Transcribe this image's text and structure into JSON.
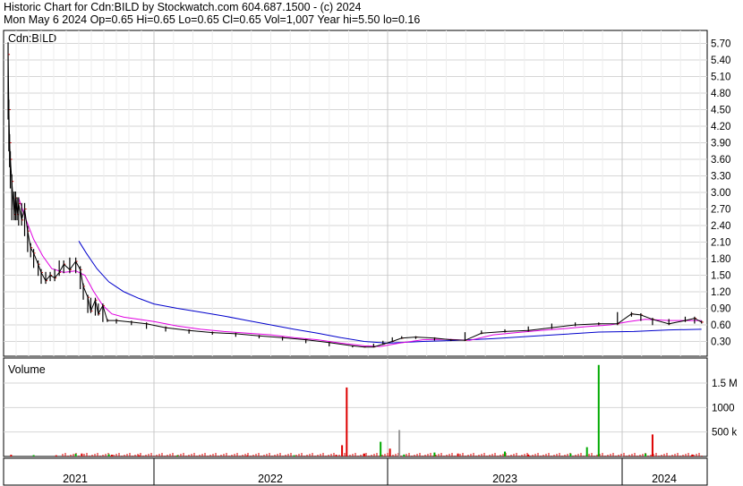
{
  "header": {
    "line1": "Historic Chart for Cdn:BILD by Stockwatch.com 604.687.1500 - (c) 2024",
    "line2": "Mon May  6 2024  Op=0.65  Hi=0.65  Lo=0.65  Cl=0.65  Vol=1,007  Year hi=5.50  lo=0.16"
  },
  "chart_data": [
    {
      "type": "line",
      "symbol_label": "Cdn:BILD",
      "x_tick_labels": [
        "2021",
        "2022",
        "2023",
        "2024"
      ],
      "y_tick_labels": [
        "5.70",
        "5.40",
        "5.10",
        "4.80",
        "4.50",
        "4.20",
        "3.90",
        "3.60",
        "3.30",
        "3.00",
        "2.70",
        "2.40",
        "2.10",
        "1.80",
        "1.50",
        "1.20",
        "0.90",
        "0.60",
        "0.30"
      ],
      "ylim": [
        0.13,
        5.85
      ],
      "grid": true,
      "colors": {
        "price": "#000000",
        "up_tick": "#cc0000",
        "short_ma": "#e000e0",
        "long_ma": "#0000cc"
      },
      "price_series": [
        {
          "t": 2021.03,
          "v": 5.5
        },
        {
          "t": 2021.035,
          "v": 4.5
        },
        {
          "t": 2021.04,
          "v": 3.9
        },
        {
          "t": 2021.045,
          "v": 3.6
        },
        {
          "t": 2021.055,
          "v": 3.2
        },
        {
          "t": 2021.07,
          "v": 2.6
        },
        {
          "t": 2021.08,
          "v": 2.9
        },
        {
          "t": 2021.09,
          "v": 2.6
        },
        {
          "t": 2021.1,
          "v": 2.8
        },
        {
          "t": 2021.12,
          "v": 2.5
        },
        {
          "t": 2021.14,
          "v": 2.7
        },
        {
          "t": 2021.16,
          "v": 2.3
        },
        {
          "t": 2021.18,
          "v": 2.0
        },
        {
          "t": 2021.2,
          "v": 1.9
        },
        {
          "t": 2021.23,
          "v": 1.7
        },
        {
          "t": 2021.25,
          "v": 1.55
        },
        {
          "t": 2021.28,
          "v": 1.4
        },
        {
          "t": 2021.31,
          "v": 1.5
        },
        {
          "t": 2021.34,
          "v": 1.45
        },
        {
          "t": 2021.37,
          "v": 1.55
        },
        {
          "t": 2021.4,
          "v": 1.7
        },
        {
          "t": 2021.44,
          "v": 1.6
        },
        {
          "t": 2021.48,
          "v": 1.75
        },
        {
          "t": 2021.51,
          "v": 1.6
        },
        {
          "t": 2021.53,
          "v": 1.3
        },
        {
          "t": 2021.56,
          "v": 1.1
        },
        {
          "t": 2021.58,
          "v": 0.85
        },
        {
          "t": 2021.61,
          "v": 1.05
        },
        {
          "t": 2021.63,
          "v": 0.8
        },
        {
          "t": 2021.66,
          "v": 0.95
        },
        {
          "t": 2021.69,
          "v": 0.68
        },
        {
          "t": 2021.75,
          "v": 0.68
        },
        {
          "t": 2021.85,
          "v": 0.65
        },
        {
          "t": 2021.95,
          "v": 0.62
        },
        {
          "t": 2022.05,
          "v": 0.55
        },
        {
          "t": 2022.15,
          "v": 0.5
        },
        {
          "t": 2022.25,
          "v": 0.46
        },
        {
          "t": 2022.35,
          "v": 0.44
        },
        {
          "t": 2022.45,
          "v": 0.4
        },
        {
          "t": 2022.55,
          "v": 0.37
        },
        {
          "t": 2022.65,
          "v": 0.33
        },
        {
          "t": 2022.75,
          "v": 0.28
        },
        {
          "t": 2022.85,
          "v": 0.22
        },
        {
          "t": 2022.9,
          "v": 0.2
        },
        {
          "t": 2022.94,
          "v": 0.2
        },
        {
          "t": 2022.98,
          "v": 0.25
        },
        {
          "t": 2023.02,
          "v": 0.3
        },
        {
          "t": 2023.06,
          "v": 0.36
        },
        {
          "t": 2023.12,
          "v": 0.38
        },
        {
          "t": 2023.2,
          "v": 0.36
        },
        {
          "t": 2023.27,
          "v": 0.33
        },
        {
          "t": 2023.33,
          "v": 0.32
        },
        {
          "t": 2023.4,
          "v": 0.45
        },
        {
          "t": 2023.5,
          "v": 0.48
        },
        {
          "t": 2023.6,
          "v": 0.5
        },
        {
          "t": 2023.7,
          "v": 0.55
        },
        {
          "t": 2023.8,
          "v": 0.6
        },
        {
          "t": 2023.9,
          "v": 0.62
        },
        {
          "t": 2023.98,
          "v": 0.62
        },
        {
          "t": 2024.04,
          "v": 0.8
        },
        {
          "t": 2024.08,
          "v": 0.78
        },
        {
          "t": 2024.13,
          "v": 0.7
        },
        {
          "t": 2024.2,
          "v": 0.62
        },
        {
          "t": 2024.27,
          "v": 0.68
        },
        {
          "t": 2024.31,
          "v": 0.72
        },
        {
          "t": 2024.34,
          "v": 0.65
        }
      ],
      "short_ma": [
        {
          "t": 2021.1,
          "v": 2.9
        },
        {
          "t": 2021.15,
          "v": 2.5
        },
        {
          "t": 2021.2,
          "v": 2.15
        },
        {
          "t": 2021.26,
          "v": 1.85
        },
        {
          "t": 2021.32,
          "v": 1.62
        },
        {
          "t": 2021.4,
          "v": 1.55
        },
        {
          "t": 2021.48,
          "v": 1.58
        },
        {
          "t": 2021.54,
          "v": 1.5
        },
        {
          "t": 2021.6,
          "v": 1.2
        },
        {
          "t": 2021.66,
          "v": 0.95
        },
        {
          "t": 2021.72,
          "v": 0.8
        },
        {
          "t": 2021.8,
          "v": 0.74
        },
        {
          "t": 2021.9,
          "v": 0.7
        },
        {
          "t": 2022.0,
          "v": 0.66
        },
        {
          "t": 2022.1,
          "v": 0.58
        },
        {
          "t": 2022.2,
          "v": 0.52
        },
        {
          "t": 2022.3,
          "v": 0.48
        },
        {
          "t": 2022.4,
          "v": 0.45
        },
        {
          "t": 2022.5,
          "v": 0.42
        },
        {
          "t": 2022.6,
          "v": 0.37
        },
        {
          "t": 2022.7,
          "v": 0.33
        },
        {
          "t": 2022.8,
          "v": 0.27
        },
        {
          "t": 2022.9,
          "v": 0.22
        },
        {
          "t": 2022.97,
          "v": 0.21
        },
        {
          "t": 2023.05,
          "v": 0.27
        },
        {
          "t": 2023.15,
          "v": 0.33
        },
        {
          "t": 2023.25,
          "v": 0.34
        },
        {
          "t": 2023.35,
          "v": 0.32
        },
        {
          "t": 2023.45,
          "v": 0.42
        },
        {
          "t": 2023.55,
          "v": 0.46
        },
        {
          "t": 2023.65,
          "v": 0.5
        },
        {
          "t": 2023.75,
          "v": 0.53
        },
        {
          "t": 2023.85,
          "v": 0.57
        },
        {
          "t": 2023.95,
          "v": 0.6
        },
        {
          "t": 2024.03,
          "v": 0.66
        },
        {
          "t": 2024.1,
          "v": 0.7
        },
        {
          "t": 2024.2,
          "v": 0.68
        },
        {
          "t": 2024.34,
          "v": 0.68
        }
      ],
      "long_ma": [
        {
          "t": 2021.5,
          "v": 2.12
        },
        {
          "t": 2021.55,
          "v": 1.9
        },
        {
          "t": 2021.62,
          "v": 1.62
        },
        {
          "t": 2021.7,
          "v": 1.38
        },
        {
          "t": 2021.8,
          "v": 1.2
        },
        {
          "t": 2021.9,
          "v": 1.08
        },
        {
          "t": 2022.0,
          "v": 0.98
        },
        {
          "t": 2022.1,
          "v": 0.9
        },
        {
          "t": 2022.2,
          "v": 0.83
        },
        {
          "t": 2022.3,
          "v": 0.76
        },
        {
          "t": 2022.4,
          "v": 0.68
        },
        {
          "t": 2022.5,
          "v": 0.6
        },
        {
          "t": 2022.6,
          "v": 0.52
        },
        {
          "t": 2022.7,
          "v": 0.45
        },
        {
          "t": 2022.8,
          "v": 0.37
        },
        {
          "t": 2022.9,
          "v": 0.3
        },
        {
          "t": 2023.0,
          "v": 0.27
        },
        {
          "t": 2023.15,
          "v": 0.3
        },
        {
          "t": 2023.3,
          "v": 0.32
        },
        {
          "t": 2023.45,
          "v": 0.35
        },
        {
          "t": 2023.6,
          "v": 0.39
        },
        {
          "t": 2023.75,
          "v": 0.43
        },
        {
          "t": 2023.9,
          "v": 0.47
        },
        {
          "t": 2024.05,
          "v": 0.48
        },
        {
          "t": 2024.2,
          "v": 0.51
        },
        {
          "t": 2024.34,
          "v": 0.52
        }
      ]
    },
    {
      "type": "bar",
      "title": "Volume",
      "y_tick_labels": [
        "1.5 M",
        "1000",
        "500 k"
      ],
      "ylim": [
        0,
        1900000
      ],
      "colors": {
        "up": "#dd0000",
        "down": "#00aa00",
        "neutral": "#999999"
      },
      "bars": [
        {
          "t": 2021.05,
          "v": 35000,
          "c": "up"
        },
        {
          "t": 2021.2,
          "v": 28000,
          "c": "down"
        },
        {
          "t": 2021.35,
          "v": 25000,
          "c": "up"
        },
        {
          "t": 2021.48,
          "v": 55000,
          "c": "down"
        },
        {
          "t": 2021.52,
          "v": 60000,
          "c": "up"
        },
        {
          "t": 2021.7,
          "v": 45000,
          "c": "down"
        },
        {
          "t": 2021.72,
          "v": 35000,
          "c": "up"
        },
        {
          "t": 2021.9,
          "v": 25000,
          "c": "up"
        },
        {
          "t": 2022.1,
          "v": 22000,
          "c": "down"
        },
        {
          "t": 2022.4,
          "v": 25000,
          "c": "up"
        },
        {
          "t": 2022.6,
          "v": 25000,
          "c": "down"
        },
        {
          "t": 2022.78,
          "v": 35000,
          "c": "up"
        },
        {
          "t": 2022.805,
          "v": 230000,
          "c": "up"
        },
        {
          "t": 2022.825,
          "v": 1410000,
          "c": "up"
        },
        {
          "t": 2022.9,
          "v": 60000,
          "c": "up"
        },
        {
          "t": 2022.97,
          "v": 300000,
          "c": "down"
        },
        {
          "t": 2023.01,
          "v": 160000,
          "c": "up"
        },
        {
          "t": 2023.05,
          "v": 540000,
          "c": "neutral"
        },
        {
          "t": 2023.07,
          "v": 40000,
          "c": "down"
        },
        {
          "t": 2023.2,
          "v": 80000,
          "c": "down"
        },
        {
          "t": 2023.3,
          "v": 60000,
          "c": "up"
        },
        {
          "t": 2023.5,
          "v": 100000,
          "c": "down"
        },
        {
          "t": 2023.6,
          "v": 40000,
          "c": "up"
        },
        {
          "t": 2023.78,
          "v": 60000,
          "c": "down"
        },
        {
          "t": 2023.85,
          "v": 190000,
          "c": "down"
        },
        {
          "t": 2023.9,
          "v": 1870000,
          "c": "down"
        },
        {
          "t": 2024.13,
          "v": 450000,
          "c": "up"
        },
        {
          "t": 2024.1,
          "v": 60000,
          "c": "down"
        },
        {
          "t": 2024.3,
          "v": 40000,
          "c": "up"
        }
      ]
    }
  ]
}
